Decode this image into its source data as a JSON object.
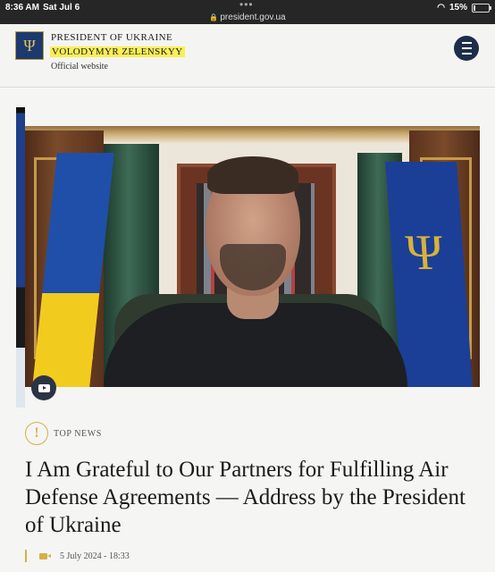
{
  "status": {
    "time": "8:36 AM",
    "date": "Sat Jul 6",
    "url": "president.gov.ua",
    "battery": "15%",
    "battery_level": 0.15
  },
  "header": {
    "title": "PRESIDENT OF UKRAINE",
    "name": "VOLODYMYR ZELENSKYY",
    "subtitle": "Official website",
    "crest_icon": "trident-icon",
    "menu_icon": "hamburger-menu-icon"
  },
  "article": {
    "category": "TOP NEWS",
    "category_icon": "exclamation-icon",
    "headline": "I Am Grateful to Our Partners for Fulfilling Air Defense Agreements — Address by the President of Ukraine",
    "datetime": "5 July 2024 - 18:33",
    "media_icon": "video-camera-icon",
    "player_icon": "youtube-icon"
  },
  "colors": {
    "accent_gold": "#d3b14a",
    "highlight": "#f9ef58",
    "menu_bg": "#1d2e4a",
    "statusbar_bg": "#262626"
  }
}
